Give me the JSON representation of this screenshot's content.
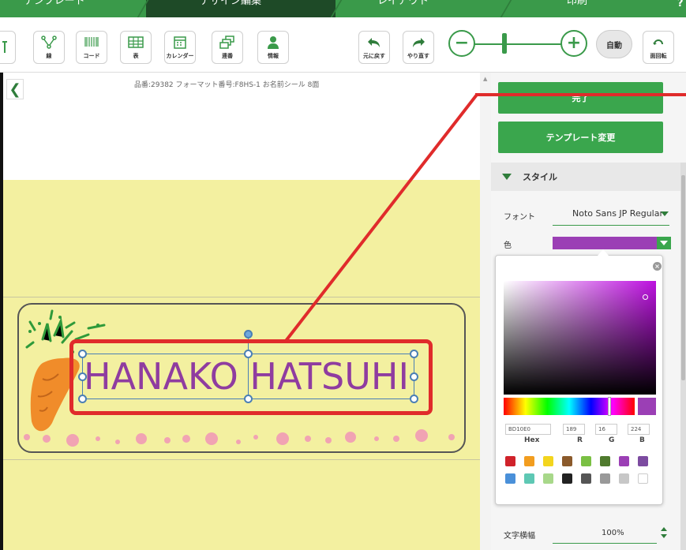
{
  "tabs": {
    "template": "テンプレート",
    "design_edit": "デザイン編集",
    "layout": "レイアウト",
    "print": "印刷"
  },
  "toolbar": {
    "line": "線",
    "code": "コード",
    "table": "表",
    "calendar": "カレンダー",
    "serial": "連番",
    "info": "情報",
    "undo": "元に戻す",
    "redo": "やり直す",
    "zoom_out": "−",
    "zoom_in": "+",
    "auto": "自動",
    "rotate": "面回転"
  },
  "canvas": {
    "meta": "品番:29382 フォーマット番号:F8HS-1 お名前シール 8面",
    "back": "❮",
    "name_text": "HANAKO HATSUHI"
  },
  "panel": {
    "top_button": "完了",
    "change_template": "テンプレート変更",
    "style_header": "スタイル",
    "font_label": "フォント",
    "font_value": "Noto Sans JP Regular",
    "color_label": "色",
    "char_width_label": "文字横幅",
    "char_width_value": "100%"
  },
  "picker": {
    "hex_value": "BD10E0",
    "r_value": "189",
    "g_value": "16",
    "b_value": "224",
    "hex_label": "Hex",
    "r_label": "R",
    "g_label": "G",
    "b_label": "B",
    "close": "×",
    "current_color": "#bd10e0",
    "swatches": [
      "#d0222a",
      "#f29d1f",
      "#f3d51e",
      "#8b5a2b",
      "#7ac043",
      "#4f7a2e",
      "#9b3fb5",
      "#7c4ba0",
      "#4a90d9",
      "#5ec8b4",
      "#a8d88a",
      "#222222",
      "#555555",
      "#999999",
      "#c7c7c7",
      "#ffffff"
    ]
  }
}
